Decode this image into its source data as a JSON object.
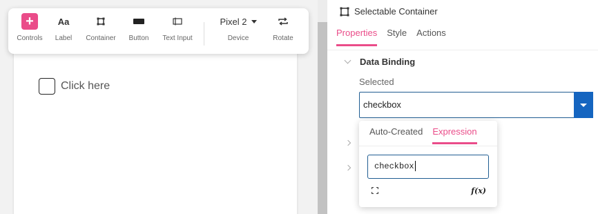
{
  "toolbar": {
    "items": [
      {
        "label": "Controls",
        "icon": "plus-icon"
      },
      {
        "label": "Label",
        "icon_text": "Aa"
      },
      {
        "label": "Container",
        "icon": "container-icon"
      },
      {
        "label": "Button",
        "icon": "button-icon"
      },
      {
        "label": "Text Input",
        "icon": "text-input-icon"
      },
      {
        "label": "Device",
        "value": "Pixel 2"
      },
      {
        "label": "Rotate",
        "icon": "rotate-icon"
      }
    ]
  },
  "canvas": {
    "checkbox_label": "Click here"
  },
  "panel": {
    "title": "Selectable Container",
    "tabs": [
      "Properties",
      "Style",
      "Actions"
    ],
    "active_tab": "Properties",
    "section_title": "Data Binding",
    "field_label": "Selected",
    "field_value": "checkbox"
  },
  "popover": {
    "tabs": [
      "Auto-Created",
      "Expression"
    ],
    "active_tab": "Expression",
    "input_value": "checkbox",
    "fx_label": "f(x)"
  },
  "colors": {
    "accent": "#ea4c89",
    "primary_blue": "#1565c0"
  }
}
